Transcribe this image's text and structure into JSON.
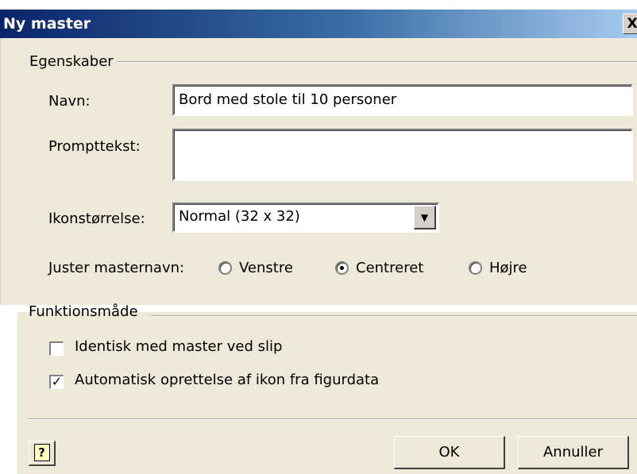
{
  "window": {
    "title": "Ny master",
    "close_glyph": "X"
  },
  "properties": {
    "group_label": "Egenskaber",
    "name_label": "Navn:",
    "name_value": "Bord med stole til 10 personer",
    "prompt_label": "Prompttekst:",
    "prompt_value": "",
    "icon_size_label": "Ikonstørrelse:",
    "icon_size_value": "Normal (32 x 32)",
    "align_label": "Juster masternavn:",
    "align_options": [
      "Venstre",
      "Centreret",
      "Højre"
    ],
    "align_selected": "Centreret"
  },
  "behavior": {
    "group_label": "Funktionsmåde",
    "match_master_label": "Identisk med master ved slip",
    "match_master_checked": false,
    "auto_icon_label": "Automatisk oprettelse af ikon fra figurdata",
    "auto_icon_checked": true
  },
  "footer": {
    "help_glyph": "?",
    "ok_label": "OK",
    "cancel_label": "Annuller"
  },
  "icons": {
    "help": "help-icon",
    "dropdown": "chevron-down-icon",
    "check": "checkmark-icon"
  }
}
